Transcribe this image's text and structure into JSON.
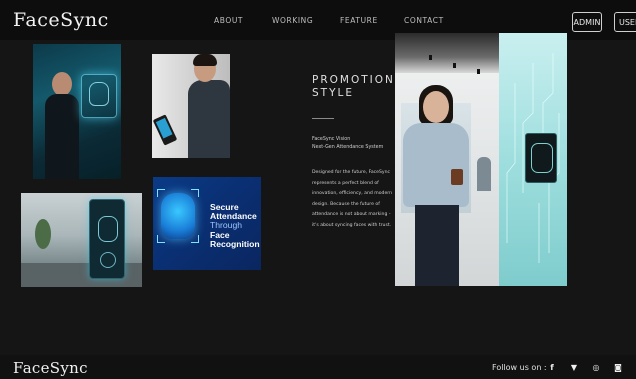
{
  "brand": {
    "logo_text": "FaceSync"
  },
  "header": {
    "nav": [
      {
        "label": "ABOUT"
      },
      {
        "label": "WORKING"
      },
      {
        "label": "FEATURE"
      },
      {
        "label": "CONTACT"
      }
    ],
    "buttons": {
      "admin_label": "ADMIN",
      "user_label": "USER"
    }
  },
  "tiles": {
    "secure_card": {
      "line1": "Secure",
      "line2": "Attendance",
      "line3": "Through",
      "line4": "Face",
      "line5": "Recognition"
    }
  },
  "promo": {
    "title_line1": "PROMOTIONAL",
    "title_line2": "STYLE",
    "sub_line1": "FaceSync Vision",
    "sub_line2": "Next-Gen Attendance System",
    "body_lines": [
      "Designed for the future, FaceSync",
      "represents a perfect blend of",
      "innovation, efficiency, and modern",
      "design. Because the future of",
      "attendance is not about marking -",
      "it's about syncing faces with trust."
    ]
  },
  "footer": {
    "logo_text": "FaceSync",
    "follow_label": "Follow us on :",
    "social": [
      {
        "icon": "facebook-icon",
        "glyph": "f"
      },
      {
        "icon": "twitter-icon",
        "glyph": "▼"
      },
      {
        "icon": "whatsapp-icon",
        "glyph": "◎"
      },
      {
        "icon": "instagram-icon",
        "glyph": "◙"
      }
    ]
  },
  "colors": {
    "background": "#151515",
    "header": "#0d0d0d",
    "card_blue": "#0b3a86"
  }
}
